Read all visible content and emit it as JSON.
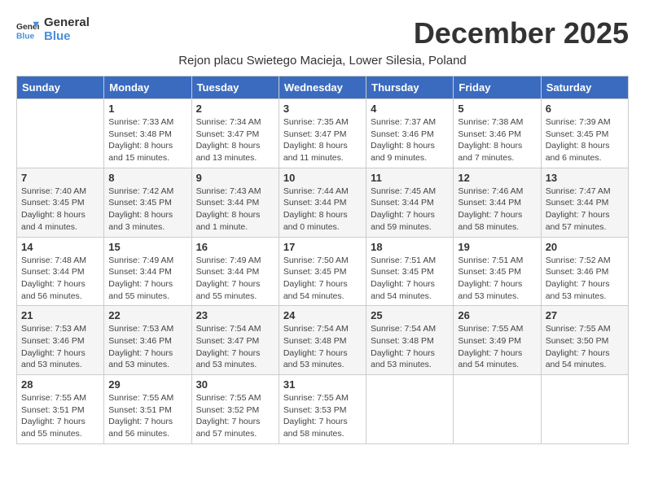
{
  "header": {
    "logo_general": "General",
    "logo_blue": "Blue",
    "month_title": "December 2025",
    "subtitle": "Rejon placu Swietego Macieja, Lower Silesia, Poland"
  },
  "weekdays": [
    "Sunday",
    "Monday",
    "Tuesday",
    "Wednesday",
    "Thursday",
    "Friday",
    "Saturday"
  ],
  "weeks": [
    [
      {
        "day": "",
        "info": ""
      },
      {
        "day": "1",
        "info": "Sunrise: 7:33 AM\nSunset: 3:48 PM\nDaylight: 8 hours\nand 15 minutes."
      },
      {
        "day": "2",
        "info": "Sunrise: 7:34 AM\nSunset: 3:47 PM\nDaylight: 8 hours\nand 13 minutes."
      },
      {
        "day": "3",
        "info": "Sunrise: 7:35 AM\nSunset: 3:47 PM\nDaylight: 8 hours\nand 11 minutes."
      },
      {
        "day": "4",
        "info": "Sunrise: 7:37 AM\nSunset: 3:46 PM\nDaylight: 8 hours\nand 9 minutes."
      },
      {
        "day": "5",
        "info": "Sunrise: 7:38 AM\nSunset: 3:46 PM\nDaylight: 8 hours\nand 7 minutes."
      },
      {
        "day": "6",
        "info": "Sunrise: 7:39 AM\nSunset: 3:45 PM\nDaylight: 8 hours\nand 6 minutes."
      }
    ],
    [
      {
        "day": "7",
        "info": "Sunrise: 7:40 AM\nSunset: 3:45 PM\nDaylight: 8 hours\nand 4 minutes."
      },
      {
        "day": "8",
        "info": "Sunrise: 7:42 AM\nSunset: 3:45 PM\nDaylight: 8 hours\nand 3 minutes."
      },
      {
        "day": "9",
        "info": "Sunrise: 7:43 AM\nSunset: 3:44 PM\nDaylight: 8 hours\nand 1 minute."
      },
      {
        "day": "10",
        "info": "Sunrise: 7:44 AM\nSunset: 3:44 PM\nDaylight: 8 hours\nand 0 minutes."
      },
      {
        "day": "11",
        "info": "Sunrise: 7:45 AM\nSunset: 3:44 PM\nDaylight: 7 hours\nand 59 minutes."
      },
      {
        "day": "12",
        "info": "Sunrise: 7:46 AM\nSunset: 3:44 PM\nDaylight: 7 hours\nand 58 minutes."
      },
      {
        "day": "13",
        "info": "Sunrise: 7:47 AM\nSunset: 3:44 PM\nDaylight: 7 hours\nand 57 minutes."
      }
    ],
    [
      {
        "day": "14",
        "info": "Sunrise: 7:48 AM\nSunset: 3:44 PM\nDaylight: 7 hours\nand 56 minutes."
      },
      {
        "day": "15",
        "info": "Sunrise: 7:49 AM\nSunset: 3:44 PM\nDaylight: 7 hours\nand 55 minutes."
      },
      {
        "day": "16",
        "info": "Sunrise: 7:49 AM\nSunset: 3:44 PM\nDaylight: 7 hours\nand 55 minutes."
      },
      {
        "day": "17",
        "info": "Sunrise: 7:50 AM\nSunset: 3:45 PM\nDaylight: 7 hours\nand 54 minutes."
      },
      {
        "day": "18",
        "info": "Sunrise: 7:51 AM\nSunset: 3:45 PM\nDaylight: 7 hours\nand 54 minutes."
      },
      {
        "day": "19",
        "info": "Sunrise: 7:51 AM\nSunset: 3:45 PM\nDaylight: 7 hours\nand 53 minutes."
      },
      {
        "day": "20",
        "info": "Sunrise: 7:52 AM\nSunset: 3:46 PM\nDaylight: 7 hours\nand 53 minutes."
      }
    ],
    [
      {
        "day": "21",
        "info": "Sunrise: 7:53 AM\nSunset: 3:46 PM\nDaylight: 7 hours\nand 53 minutes."
      },
      {
        "day": "22",
        "info": "Sunrise: 7:53 AM\nSunset: 3:46 PM\nDaylight: 7 hours\nand 53 minutes."
      },
      {
        "day": "23",
        "info": "Sunrise: 7:54 AM\nSunset: 3:47 PM\nDaylight: 7 hours\nand 53 minutes."
      },
      {
        "day": "24",
        "info": "Sunrise: 7:54 AM\nSunset: 3:48 PM\nDaylight: 7 hours\nand 53 minutes."
      },
      {
        "day": "25",
        "info": "Sunrise: 7:54 AM\nSunset: 3:48 PM\nDaylight: 7 hours\nand 53 minutes."
      },
      {
        "day": "26",
        "info": "Sunrise: 7:55 AM\nSunset: 3:49 PM\nDaylight: 7 hours\nand 54 minutes."
      },
      {
        "day": "27",
        "info": "Sunrise: 7:55 AM\nSunset: 3:50 PM\nDaylight: 7 hours\nand 54 minutes."
      }
    ],
    [
      {
        "day": "28",
        "info": "Sunrise: 7:55 AM\nSunset: 3:51 PM\nDaylight: 7 hours\nand 55 minutes."
      },
      {
        "day": "29",
        "info": "Sunrise: 7:55 AM\nSunset: 3:51 PM\nDaylight: 7 hours\nand 56 minutes."
      },
      {
        "day": "30",
        "info": "Sunrise: 7:55 AM\nSunset: 3:52 PM\nDaylight: 7 hours\nand 57 minutes."
      },
      {
        "day": "31",
        "info": "Sunrise: 7:55 AM\nSunset: 3:53 PM\nDaylight: 7 hours\nand 58 minutes."
      },
      {
        "day": "",
        "info": ""
      },
      {
        "day": "",
        "info": ""
      },
      {
        "day": "",
        "info": ""
      }
    ]
  ]
}
